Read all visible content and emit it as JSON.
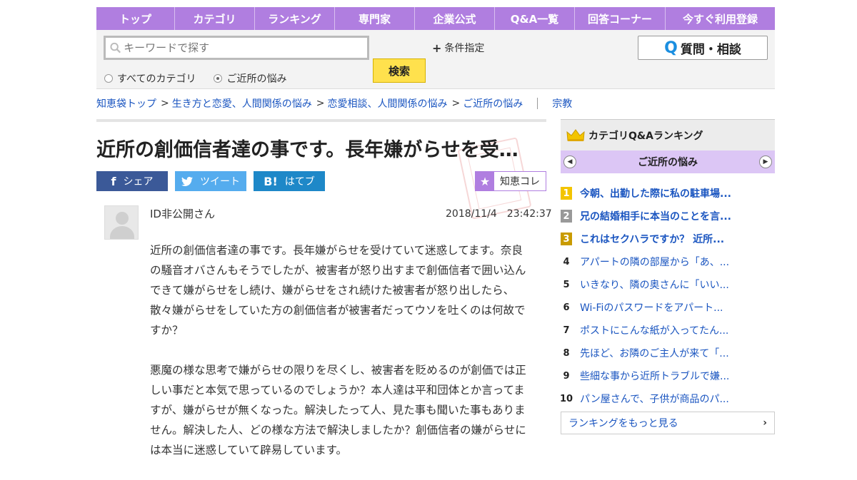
{
  "nav": [
    "トップ",
    "カテゴリ",
    "ランキング",
    "専門家",
    "企業公式",
    "Q&A一覧",
    "回答コーナー",
    "今すぐ利用登録"
  ],
  "search": {
    "placeholder": "キーワードで探す",
    "button": "検索",
    "conditions": "条件指定",
    "scope_all": "すべてのカテゴリ",
    "scope_current": "ご近所の悩み"
  },
  "ask_button": "質問・相談",
  "ask_icon": "Q",
  "breadcrumbs": [
    "知恵袋トップ",
    "生き方と恋愛、人間関係の悩み",
    "恋愛相談、人間関係の悩み",
    "ご近所の悩み"
  ],
  "tag": "宗教",
  "question": {
    "title": "近所の創価信者達の事です。長年嫌がらせを受…",
    "user": "ID非公開さん",
    "date": "2018/11/4　23:42:37",
    "paragraph1": "近所の創価信者達の事です。長年嫌がらせを受けていて迷惑してます。奈良の騒音オバさんもそうでしたが、被害者が怒り出すまで創価信者で囲い込んできて嫌がらせをし続け、嫌がらせをされ続けた被害者が怒り出したら、散々嫌がらせをしていた方の創価信者が被害者だってウソを吐くのは何故ですか？",
    "paragraph2": "悪魔の様な思考で嫌がらせの限りを尽くし、被害者を貶めるのが創価では正しい事だと本気で思っているのでしょうか？本人達は平和団体とか言ってますが、嫌がらせが無くなった。解決したって人、見た事も聞いた事もありません。解決した人、どの様な方法で解決しましたか？創価信者の嫌がらせには本当に迷惑していて辟易しています。"
  },
  "share": {
    "facebook": "シェア",
    "facebook_icon": "f",
    "twitter": "ツイート",
    "hatena": "はてブ",
    "hatena_icon": "B!",
    "chiekore": "知恵コレ"
  },
  "sidebar": {
    "title": "カテゴリQ&Aランキング",
    "category": "ご近所の悩み",
    "ranking": [
      {
        "rank": "1",
        "text": "今朝、出勤した際に私の駐車場..."
      },
      {
        "rank": "2",
        "text": "兄の結婚相手に本当のことを言..."
      },
      {
        "rank": "3",
        "text": "これはセクハラですか？ 近所..."
      },
      {
        "rank": "4",
        "text": "アパートの隣の部屋から「あ、..."
      },
      {
        "rank": "5",
        "text": "いきなり、隣の奥さんに「いい..."
      },
      {
        "rank": "6",
        "text": "Wi-Fiのパスワードをアパート..."
      },
      {
        "rank": "7",
        "text": "ポストにこんな紙が入ってたん..."
      },
      {
        "rank": "8",
        "text": "先ほど、お隣のご主人が来て「..."
      },
      {
        "rank": "9",
        "text": "些細な事から近所トラブルで嫌..."
      },
      {
        "rank": "10",
        "text": "パン屋さんで、子供が商品のパ..."
      }
    ],
    "more": "ランキングをもっと見る"
  },
  "colors": {
    "accent": "#b07ee0",
    "link": "#1a55c0",
    "search_button": "#ffe14d"
  }
}
